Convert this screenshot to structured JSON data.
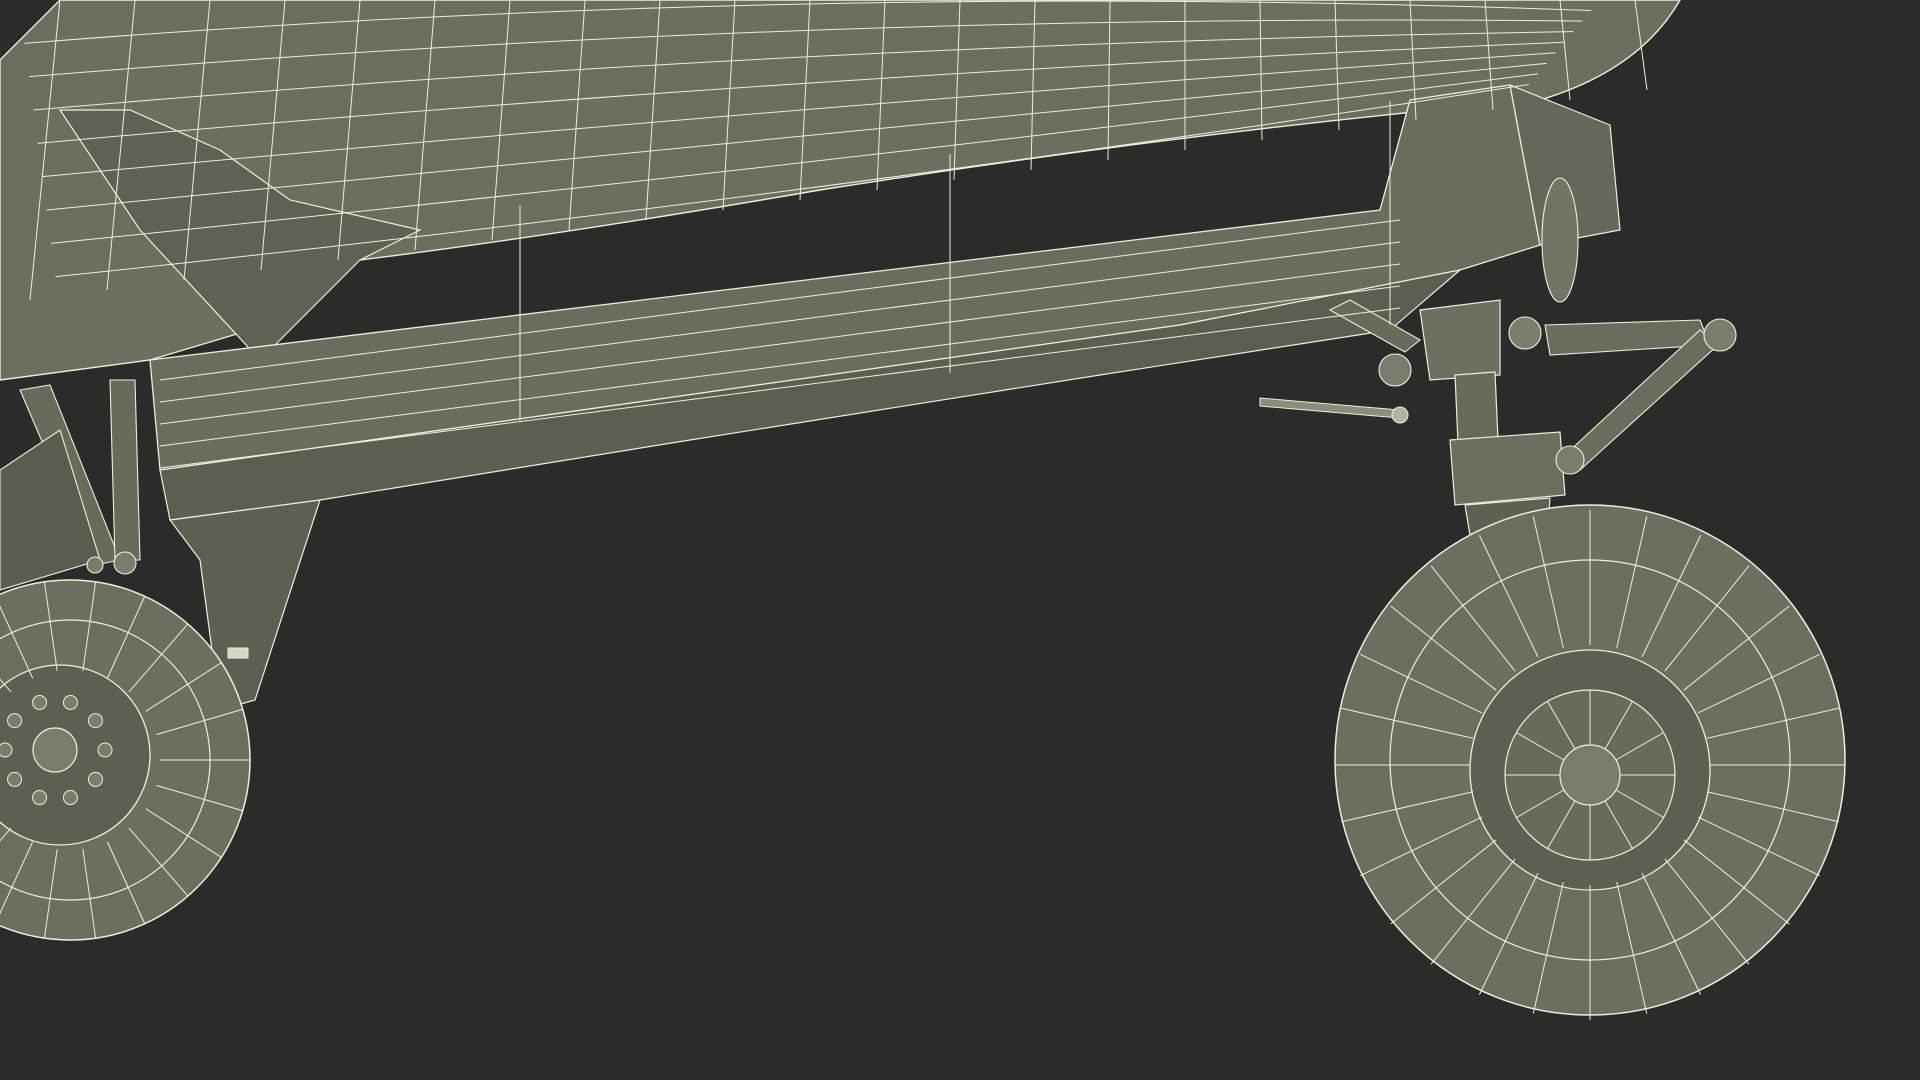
{
  "scene": {
    "background_color": "#2b2b2a",
    "surface_color": "#6c6e60",
    "surface_dark_color": "#5a5c50",
    "surface_light_color": "#7a7c6d",
    "wire_color": "#eeeedd",
    "subject": "wireframe-3d-vehicle-landing-gear"
  }
}
